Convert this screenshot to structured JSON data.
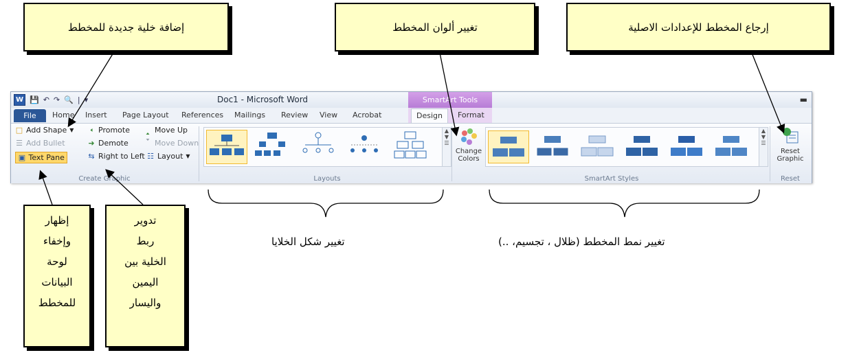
{
  "callouts": {
    "add_cell": "إضافة خلية جديدة للمخطط",
    "change_colors": "تغيير ألوان المخطط",
    "reset": "إرجاع المخطط للإعدادات الاصلية",
    "text_pane_lines": [
      "إظهار",
      "وإخفاء",
      "لوحة",
      "البيانات",
      "للمخطط"
    ],
    "rtl_lines": [
      "تدوير",
      "ربط",
      "الخلية بين",
      "اليمين",
      "واليسار"
    ],
    "layouts_caption": "تغيير شكل الخلايا",
    "styles_caption": "تغيير نمط المخطط (ظلال ، تجسيم، ..)"
  },
  "window": {
    "title": "Doc1 - Microsoft Word",
    "contextual_tab": "SmartArt Tools",
    "qat_sep": "|",
    "word_letter": "W"
  },
  "tabs": [
    "File",
    "Home",
    "Insert",
    "Page Layout",
    "References",
    "Mailings",
    "Review",
    "View",
    "Acrobat",
    "Design",
    "Format"
  ],
  "create_graphic": {
    "add_shape": "Add Shape",
    "add_bullet": "Add Bullet",
    "text_pane": "Text Pane",
    "promote": "Promote",
    "demote": "Demote",
    "right_to_left": "Right to Left",
    "move_up": "Move Up",
    "move_down": "Move Down",
    "layout": "Layout",
    "group": "Create Graphic"
  },
  "layouts": {
    "group": "Layouts"
  },
  "change_colors": {
    "line1": "Change",
    "line2": "Colors"
  },
  "styles": {
    "group": "SmartArt Styles"
  },
  "reset": {
    "line1": "Reset",
    "line2": "Graphic",
    "group": "Reset"
  },
  "colors": {
    "callout_bg": "#ffffc6",
    "file_tab": "#2b5797",
    "contextual": "#b77dd6",
    "selection": "#fff3c0"
  }
}
